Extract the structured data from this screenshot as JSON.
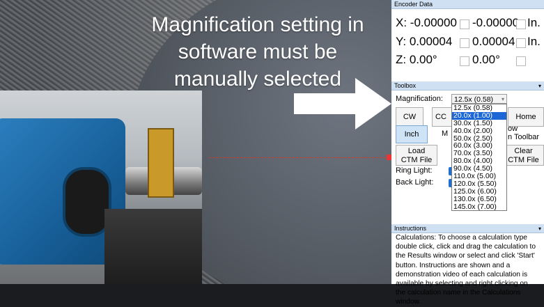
{
  "overlay": {
    "headline_lines": [
      "Magnification setting in",
      "software must be",
      "manually selected"
    ]
  },
  "encoder": {
    "header": "Encoder Data",
    "rows": [
      {
        "axis": "X: -0.00000",
        "value2": "-0.00000",
        "unit": "In."
      },
      {
        "axis": "Y: 0.00004",
        "value2": "0.00004",
        "unit": "In."
      },
      {
        "axis": "Z: 0.00°",
        "value2": "0.00°",
        "unit": ""
      }
    ]
  },
  "toolbox": {
    "header": "Toolbox",
    "magnification_label": "Magnification:",
    "magnification_value": "12.5x (0.58)",
    "options": [
      "12.5x (0.58)",
      "20.0x (1.00)",
      "30.0x (1.50)",
      "40.0x (2.00)",
      "50.0x (2.50)",
      "60.0x (3.00)",
      "70.0x (3.50)",
      "80.0x (4.00)",
      "90.0x (4.50)",
      "110.0x (5.00)",
      "120.0x (5.50)",
      "125.0x (6.00)",
      "130.0x (6.50)",
      "145.0x (7.00)"
    ],
    "selected_option_index": 1,
    "cw_label": "CW",
    "ccw_label_visible": "CC",
    "home_label": "Home",
    "inch_label": "Inch",
    "metric_label_visible": "M",
    "show_label_visible": "ow",
    "toolbar_label_visible": "n Toolbar",
    "load_label_line1": "Load",
    "load_label_line2": "CTM File",
    "clear_label_line1": "Clear",
    "clear_label_line2": "CTM File",
    "ring_light_label": "Ring Light:",
    "back_light_label": "Back Light:"
  },
  "instructions": {
    "header": "Instructions",
    "text": "Calculations: To choose a calculation type double click, click and drag the calculation to the Results window or select and click 'Start' button.  Instructions are shown and a demonstration video of each calculation is available by selecting and right clicking on the calculation name in the Calculations window."
  },
  "colors": {
    "panel_header_bg": "#cfe0f3",
    "selected_option_bg": "#1c66d6",
    "inch_button_bg": "#cfe3f7"
  }
}
